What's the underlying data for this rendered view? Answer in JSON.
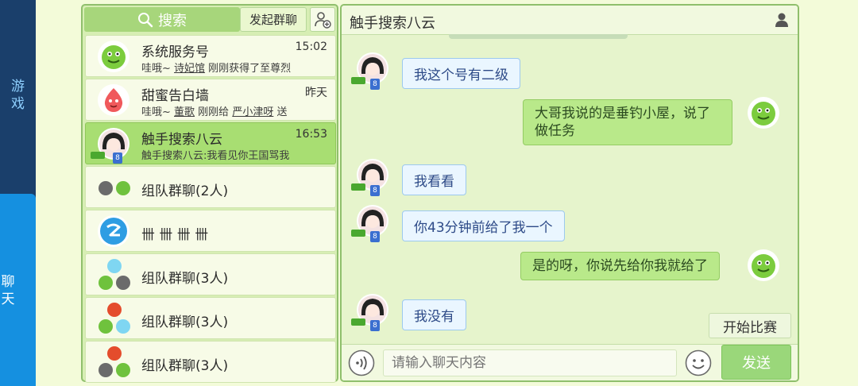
{
  "rail": {
    "games": "游戏",
    "chat": "聊天"
  },
  "left": {
    "search_label": "搜索",
    "launch_group_label": "发起群聊",
    "conversations": [
      {
        "name": "系统服务号",
        "time": "15:02",
        "preview_pre": "哇哦~ ",
        "preview_link": "诗妃馆",
        "preview_post": " 刚刚获得了至尊烈"
      },
      {
        "name": "甜蜜告白墙",
        "time": "昨天",
        "preview_pre": "哇哦~ ",
        "preview_link": "董歌",
        "preview_mid": " 刚刚给 ",
        "preview_link2": "严小津呀",
        "preview_post": " 送"
      },
      {
        "name": "触手搜索八云",
        "time": "16:53",
        "preview": "触手搜索八云:我看见你王国骂我",
        "badge": "8"
      },
      {
        "name": "组队群聊(2人)"
      },
      {
        "name": "卌 卌 卌 卌"
      },
      {
        "name": "组队群聊(3人)"
      },
      {
        "name": "组队群聊(3人)"
      },
      {
        "name": "组队群聊(3人)"
      }
    ]
  },
  "chat": {
    "title": "触手搜索八云",
    "messages": [
      {
        "from": "other",
        "text": "我这个号有二级",
        "badge": "8"
      },
      {
        "from": "me",
        "text": "大哥我说的是垂钓小屋，说了做任务"
      },
      {
        "from": "other",
        "text": "我看看",
        "badge": "8"
      },
      {
        "from": "other",
        "text": "你43分钟前给了我一个",
        "badge": "8"
      },
      {
        "from": "me",
        "text": "是的呀，你说先给你我就给了"
      },
      {
        "from": "other",
        "text": "我没有",
        "badge": "8"
      }
    ],
    "start_match_label": "开始比赛",
    "input_placeholder": "请输入聊天内容",
    "send_label": "发送"
  },
  "colors": {
    "accent_green": "#a8de72",
    "rail_blue": "#1590e0",
    "rail_dark": "#1a3f6b"
  }
}
